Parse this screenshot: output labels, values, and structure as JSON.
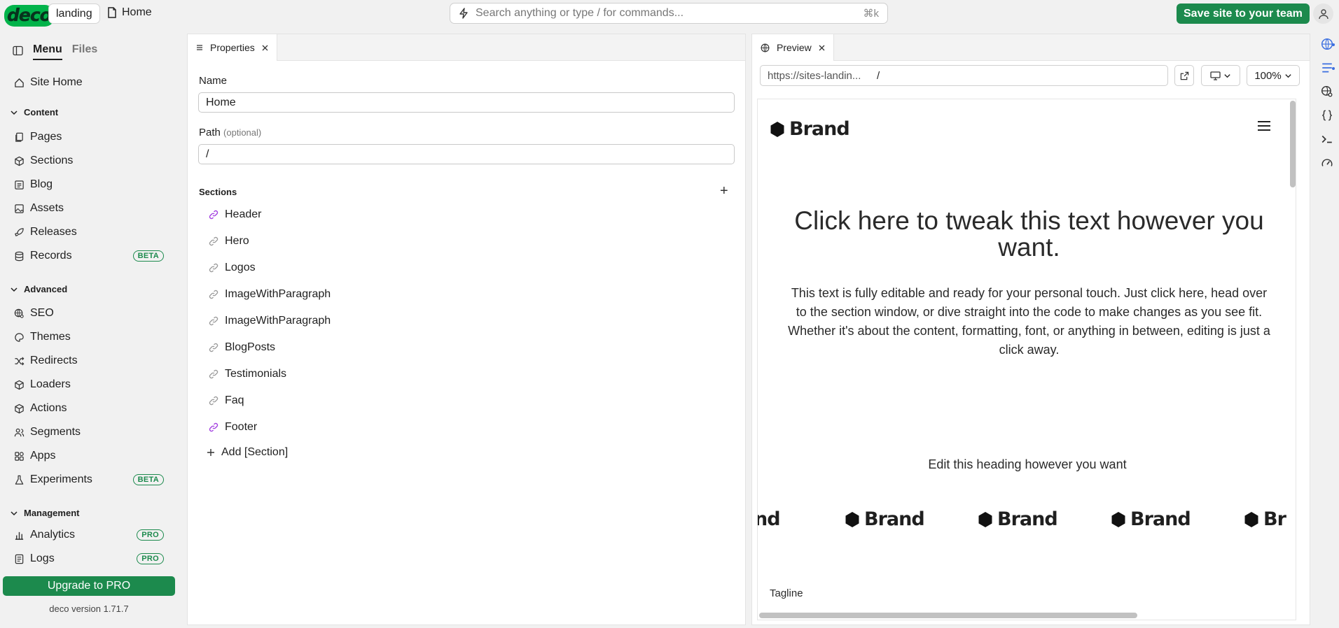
{
  "app": {
    "logo_text": "deco",
    "site": "landing",
    "page": "Home",
    "search_placeholder": "Search anything or type / for commands...",
    "search_shortcut": "⌘k",
    "save_label": "Save site to your team"
  },
  "sidebar": {
    "tabs": [
      "Menu",
      "Files"
    ],
    "site_home": "Site Home",
    "groups": {
      "content": "Content",
      "advanced": "Advanced",
      "management": "Management"
    },
    "content_items": [
      {
        "label": "Pages",
        "icon": "pages-icon"
      },
      {
        "label": "Sections",
        "icon": "cube-icon"
      },
      {
        "label": "Blog",
        "icon": "blog-icon"
      },
      {
        "label": "Assets",
        "icon": "image-icon"
      },
      {
        "label": "Releases",
        "icon": "rocket-icon"
      },
      {
        "label": "Records",
        "icon": "database-icon",
        "badge": "BETA"
      }
    ],
    "advanced_items": [
      {
        "label": "SEO",
        "icon": "globe-search-icon"
      },
      {
        "label": "Themes",
        "icon": "palette-icon"
      },
      {
        "label": "Redirects",
        "icon": "shuffle-icon"
      },
      {
        "label": "Loaders",
        "icon": "cube-icon"
      },
      {
        "label": "Actions",
        "icon": "cube-icon"
      },
      {
        "label": "Segments",
        "icon": "users-icon"
      },
      {
        "label": "Apps",
        "icon": "apps-icon"
      },
      {
        "label": "Experiments",
        "icon": "flask-icon",
        "badge": "BETA"
      }
    ],
    "management_items": [
      {
        "label": "Analytics",
        "icon": "bar-chart-icon",
        "badge": "PRO"
      },
      {
        "label": "Logs",
        "icon": "log-icon",
        "badge": "PRO"
      }
    ],
    "upgrade_label": "Upgrade to PRO",
    "version": "deco version 1.71.7"
  },
  "properties": {
    "tab_label": "Properties",
    "name_label": "Name",
    "name_value": "Home",
    "path_label": "Path",
    "path_optional": "(optional)",
    "path_value": "/",
    "sections_label": "Sections",
    "sections": [
      {
        "label": "Header",
        "linked": true
      },
      {
        "label": "Hero",
        "linked": false
      },
      {
        "label": "Logos",
        "linked": false
      },
      {
        "label": "ImageWithParagraph",
        "linked": false
      },
      {
        "label": "ImageWithParagraph",
        "linked": false
      },
      {
        "label": "BlogPosts",
        "linked": false
      },
      {
        "label": "Testimonials",
        "linked": false
      },
      {
        "label": "Faq",
        "linked": false
      },
      {
        "label": "Footer",
        "linked": true
      }
    ],
    "add_section_label": "Add [Section]"
  },
  "preview": {
    "tab_label": "Preview",
    "url_host": "https://sites-landin...",
    "url_path": "/",
    "zoom": "100%",
    "page": {
      "brand": "Brand",
      "hero_title": "Click here to tweak this text however you want.",
      "hero_text": "This text is fully editable and ready for your personal touch. Just click here, head over to the section window, or dive straight into the code to make changes as you see fit. Whether it's about the content, formatting, font, or anything in between, editing is just a click away.",
      "logos_title": "Edit this heading however you want",
      "logo_strip": [
        "nd",
        "Brand",
        "Brand",
        "Brand",
        "Br"
      ],
      "tagline": "Tagline"
    }
  },
  "colors": {
    "accent_green": "#1c8a4d",
    "link_purple": "#a23ee0",
    "rail_dot_blue": "#3b6fe0"
  }
}
